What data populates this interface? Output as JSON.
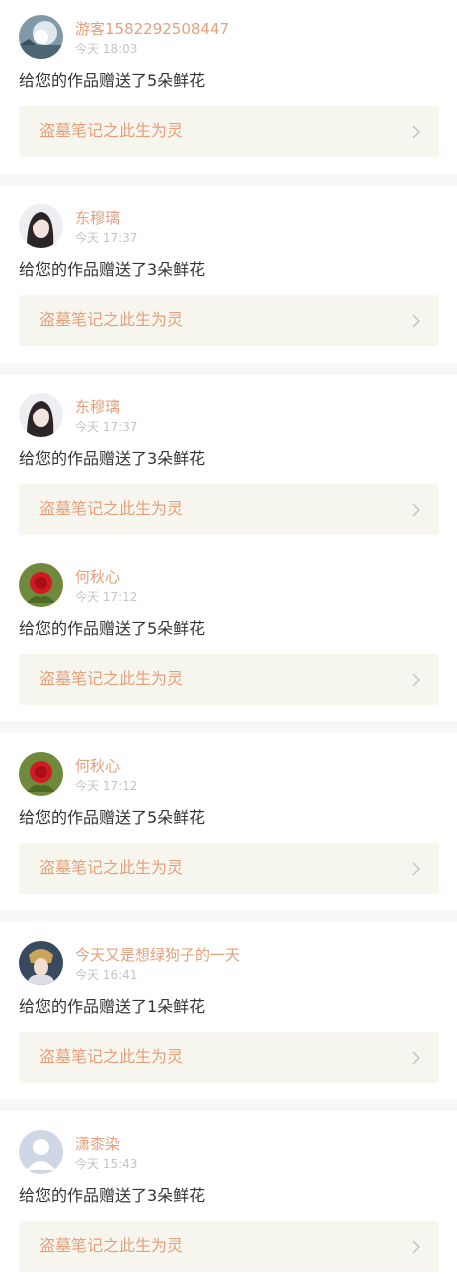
{
  "notifications": [
    {
      "user_name": "游客1582292508447",
      "time": "今天 18:03",
      "message": "给您的作品赠送了5朵鲜花",
      "work_title": "盗墓笔记之此生为灵",
      "avatar": "landscape-avatar"
    },
    {
      "user_name": "东穆璃",
      "time": "今天 17:37",
      "message": "给您的作品赠送了3朵鲜花",
      "work_title": "盗墓笔记之此生为灵",
      "avatar": "girl-avatar"
    },
    {
      "user_name": "东穆璃",
      "time": "今天 17:37",
      "message": "给您的作品赠送了3朵鲜花",
      "work_title": "盗墓笔记之此生为灵",
      "avatar": "girl-avatar"
    },
    {
      "user_name": "何秋心",
      "time": "今天 17:12",
      "message": "给您的作品赠送了5朵鲜花",
      "work_title": "盗墓笔记之此生为灵",
      "avatar": "rose-avatar"
    },
    {
      "user_name": "何秋心",
      "time": "今天 17:12",
      "message": "给您的作品赠送了5朵鲜花",
      "work_title": "盗墓笔记之此生为灵",
      "avatar": "rose-avatar"
    },
    {
      "user_name": "今天又是想绿狗子的一天",
      "time": "今天 16:41",
      "message": "给您的作品赠送了1朵鲜花",
      "work_title": "盗墓笔记之此生为灵",
      "avatar": "costume-avatar"
    },
    {
      "user_name": "潇桼染",
      "time": "今天 15:43",
      "message": "给您的作品赠送了3朵鲜花",
      "work_title": "盗墓笔记之此生为灵",
      "avatar": "default-avatar"
    }
  ],
  "colors": {
    "accent": "#e4a07a",
    "card_bg": "#f7f6ee",
    "separator": "#f7f7f7",
    "text": "#333333",
    "time": "#c4c4c4"
  }
}
